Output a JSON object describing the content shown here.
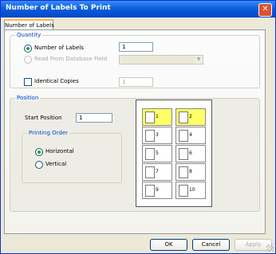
{
  "window": {
    "title": "Number of Labels To Print",
    "close_icon": "close-icon"
  },
  "tabs": [
    {
      "label": "Number of Labels",
      "active": true
    }
  ],
  "quantity": {
    "title": "Quantity",
    "number_of_labels_label": "Number of Labels",
    "number_of_labels_value": "1",
    "read_from_db_label": "Read From Database Field",
    "read_from_db_value": "",
    "identical_copies_label": "Identical Copies",
    "identical_copies_value": "1",
    "selected": "number_of_labels",
    "identical_copies_checked": false
  },
  "position": {
    "title": "Position",
    "start_position_label": "Start Position",
    "start_position_value": "1",
    "printing_order": {
      "title": "Printing Order",
      "horizontal_label": "Horizontal",
      "vertical_label": "Vertical",
      "selected": "horizontal"
    }
  },
  "sheet": {
    "cells": [
      {
        "num": "1",
        "selected": true
      },
      {
        "num": "2",
        "selected": true
      },
      {
        "num": "3",
        "selected": false
      },
      {
        "num": "4",
        "selected": false
      },
      {
        "num": "5",
        "selected": false
      },
      {
        "num": "6",
        "selected": false
      },
      {
        "num": "7",
        "selected": false
      },
      {
        "num": "8",
        "selected": false
      },
      {
        "num": "9",
        "selected": false
      },
      {
        "num": "10",
        "selected": false
      }
    ],
    "highlight_color": "#ffff66"
  },
  "buttons": {
    "ok": "OK",
    "cancel": "Cancel",
    "apply": "Apply"
  }
}
